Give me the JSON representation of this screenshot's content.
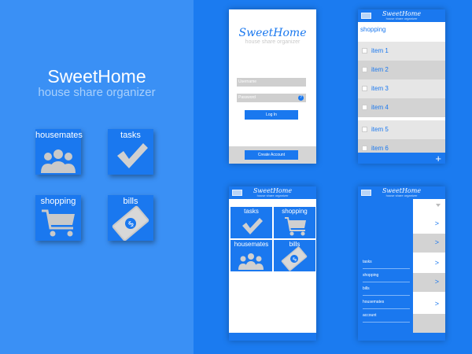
{
  "brand": {
    "title": "SweetHome",
    "subtitle": "house share organizer"
  },
  "tiles": [
    {
      "label": "housemates",
      "icon": "people-icon"
    },
    {
      "label": "tasks",
      "icon": "checkmark-icon"
    },
    {
      "label": "shopping",
      "icon": "cart-icon"
    },
    {
      "label": "bills",
      "icon": "banknote-icon"
    }
  ],
  "login": {
    "title": "SweetHome",
    "subtitle": "house share organizer",
    "username_placeholder": "Username",
    "password_placeholder": "Password",
    "help": "?",
    "login_button": "Log In",
    "create_button": "Create Account"
  },
  "mini_header": {
    "title": "SweetHome",
    "subtitle": "house share organizer"
  },
  "shopping": {
    "header": "shopping",
    "items": [
      "item 1",
      "item 2",
      "item 3",
      "item 4",
      "item 5",
      "item 6"
    ],
    "add": "+"
  },
  "home_grid": [
    {
      "label": "tasks",
      "icon": "checkmark-icon"
    },
    {
      "label": "shopping",
      "icon": "cart-icon"
    },
    {
      "label": "housemates",
      "icon": "people-icon"
    },
    {
      "label": "bills",
      "icon": "banknote-icon"
    }
  ],
  "drawer": {
    "items": [
      "tasks",
      "shopping",
      "bills",
      "housemates",
      "account"
    ],
    "chevron": ">"
  },
  "colors": {
    "accent": "#1a78ef",
    "background": "#1b7bf0",
    "panel": "#3a90f5",
    "gray": "#d5d5d5"
  }
}
